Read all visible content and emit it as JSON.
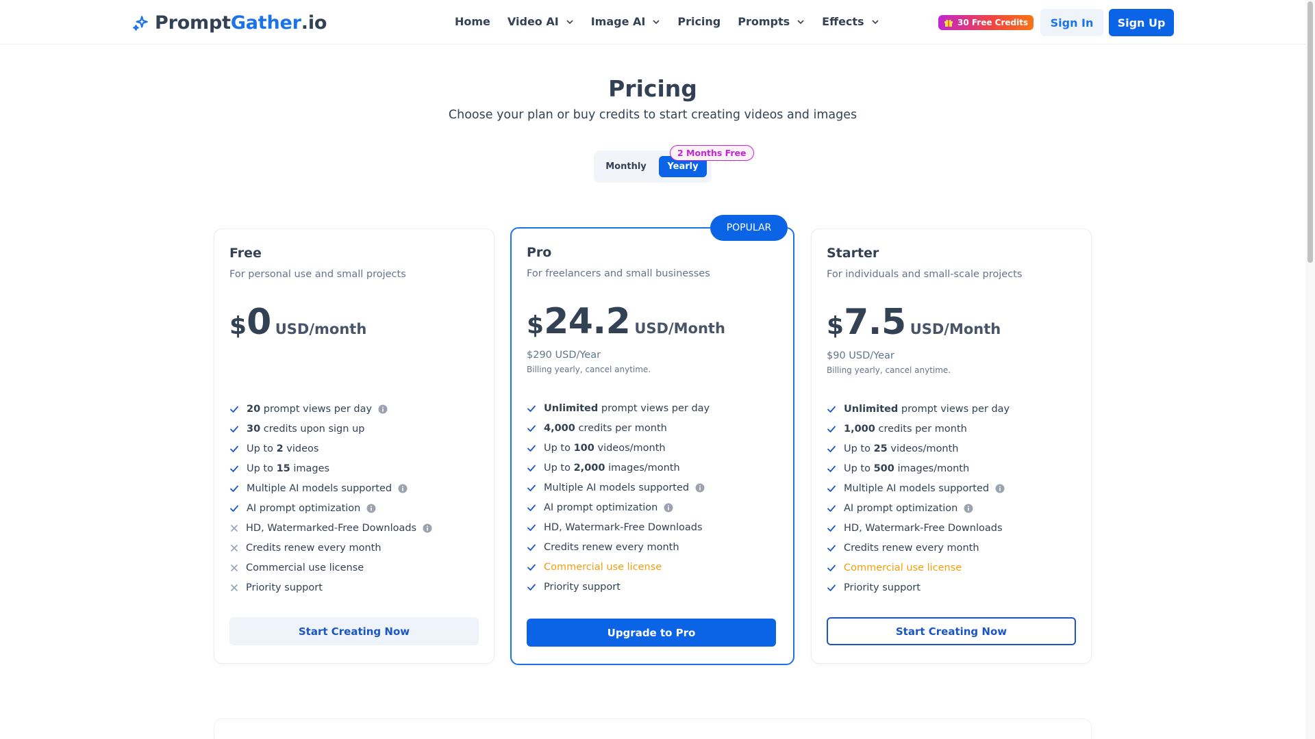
{
  "header": {
    "logo_main": "Prompt",
    "logo_accent": "Gather",
    "logo_tld": ".io",
    "logo_icon": "sparkle-icon",
    "nav": [
      {
        "label": "Home",
        "dropdown": false
      },
      {
        "label": "Video AI",
        "dropdown": true
      },
      {
        "label": "Image AI",
        "dropdown": true
      },
      {
        "label": "Pricing",
        "dropdown": false
      },
      {
        "label": "Prompts",
        "dropdown": true
      },
      {
        "label": "Effects",
        "dropdown": true
      }
    ],
    "credits_badge": "30 Free Credits",
    "sign_in": "Sign In",
    "sign_up": "Sign Up"
  },
  "hero": {
    "title": "Pricing",
    "subtitle": "Choose your plan or buy credits to start creating videos and images"
  },
  "billing_toggle": {
    "monthly": "Monthly",
    "yearly": "Yearly",
    "selected": "Yearly",
    "promo": "2 Months Free"
  },
  "colors": {
    "accent": "#0b63e5",
    "commercial": "#f59e0b",
    "promo": "#c026d3"
  },
  "plans": {
    "free": {
      "name": "Free",
      "desc": "For personal use and small projects",
      "currency": "$",
      "amount": "0",
      "unit": "USD/month",
      "features": [
        {
          "pre": "",
          "bold": "20",
          "post": " prompt views per day",
          "ok": true,
          "info": true
        },
        {
          "pre": "",
          "bold": "30",
          "post": " credits upon sign up",
          "ok": true,
          "info": false
        },
        {
          "pre": "Up to ",
          "bold": "2",
          "post": " videos",
          "ok": true,
          "info": false
        },
        {
          "pre": "Up to ",
          "bold": "15",
          "post": " images",
          "ok": true,
          "info": false
        },
        {
          "pre": "Multiple AI models supported",
          "bold": "",
          "post": "",
          "ok": true,
          "info": true
        },
        {
          "pre": "AI prompt optimization",
          "bold": "",
          "post": "",
          "ok": true,
          "info": true
        },
        {
          "pre": "HD, Watermarked-Free Downloads",
          "bold": "",
          "post": "",
          "ok": false,
          "info": true
        },
        {
          "pre": "Credits renew every month",
          "bold": "",
          "post": "",
          "ok": false,
          "info": false
        },
        {
          "pre": "Commercial use license",
          "bold": "",
          "post": "",
          "ok": false,
          "info": false
        },
        {
          "pre": "Priority support",
          "bold": "",
          "post": "",
          "ok": false,
          "info": false
        }
      ],
      "cta": "Start Creating Now"
    },
    "pro": {
      "badge": "POPULAR",
      "name": "Pro",
      "desc": "For freelancers and small businesses",
      "currency": "$",
      "amount": "24.2",
      "unit": "USD/Month",
      "yearly": "$290 USD/Year",
      "billing_note": "Billing yearly, cancel anytime.",
      "features": [
        {
          "pre": "",
          "bold": "Unlimited",
          "post": " prompt views per day",
          "ok": true,
          "info": false
        },
        {
          "pre": "",
          "bold": "4,000",
          "post": " credits per month",
          "ok": true,
          "info": false
        },
        {
          "pre": "Up to ",
          "bold": "100",
          "post": " videos/month",
          "ok": true,
          "info": false
        },
        {
          "pre": "Up to ",
          "bold": "2,000",
          "post": " images/month",
          "ok": true,
          "info": false
        },
        {
          "pre": "Multiple AI models supported",
          "bold": "",
          "post": "",
          "ok": true,
          "info": true
        },
        {
          "pre": "AI prompt optimization",
          "bold": "",
          "post": "",
          "ok": true,
          "info": true
        },
        {
          "pre": "HD, Watermark-Free Downloads",
          "bold": "",
          "post": "",
          "ok": true,
          "info": false
        },
        {
          "pre": "Credits renew every month",
          "bold": "",
          "post": "",
          "ok": true,
          "info": false
        },
        {
          "pre": "Commercial use license",
          "bold": "",
          "post": "",
          "ok": true,
          "info": false,
          "highlight": true
        },
        {
          "pre": "Priority support",
          "bold": "",
          "post": "",
          "ok": true,
          "info": false
        }
      ],
      "cta": "Upgrade to Pro"
    },
    "starter": {
      "name": "Starter",
      "desc": "For individuals and small-scale projects",
      "currency": "$",
      "amount": "7.5",
      "unit": "USD/Month",
      "yearly": "$90 USD/Year",
      "billing_note": "Billing yearly, cancel anytime.",
      "features": [
        {
          "pre": "",
          "bold": "Unlimited",
          "post": " prompt views per day",
          "ok": true,
          "info": false
        },
        {
          "pre": "",
          "bold": "1,000",
          "post": " credits per month",
          "ok": true,
          "info": false
        },
        {
          "pre": "Up to ",
          "bold": "25",
          "post": " videos/month",
          "ok": true,
          "info": false
        },
        {
          "pre": "Up to ",
          "bold": "500",
          "post": " images/month",
          "ok": true,
          "info": false
        },
        {
          "pre": "Multiple AI models supported",
          "bold": "",
          "post": "",
          "ok": true,
          "info": true
        },
        {
          "pre": "AI prompt optimization",
          "bold": "",
          "post": "",
          "ok": true,
          "info": true
        },
        {
          "pre": "HD, Watermark-Free Downloads",
          "bold": "",
          "post": "",
          "ok": true,
          "info": false
        },
        {
          "pre": "Credits renew every month",
          "bold": "",
          "post": "",
          "ok": true,
          "info": false
        },
        {
          "pre": "Commercial use license",
          "bold": "",
          "post": "",
          "ok": true,
          "info": false,
          "highlight": true
        },
        {
          "pre": "Priority support",
          "bold": "",
          "post": "",
          "ok": true,
          "info": false
        }
      ],
      "cta": "Start Creating Now"
    }
  }
}
